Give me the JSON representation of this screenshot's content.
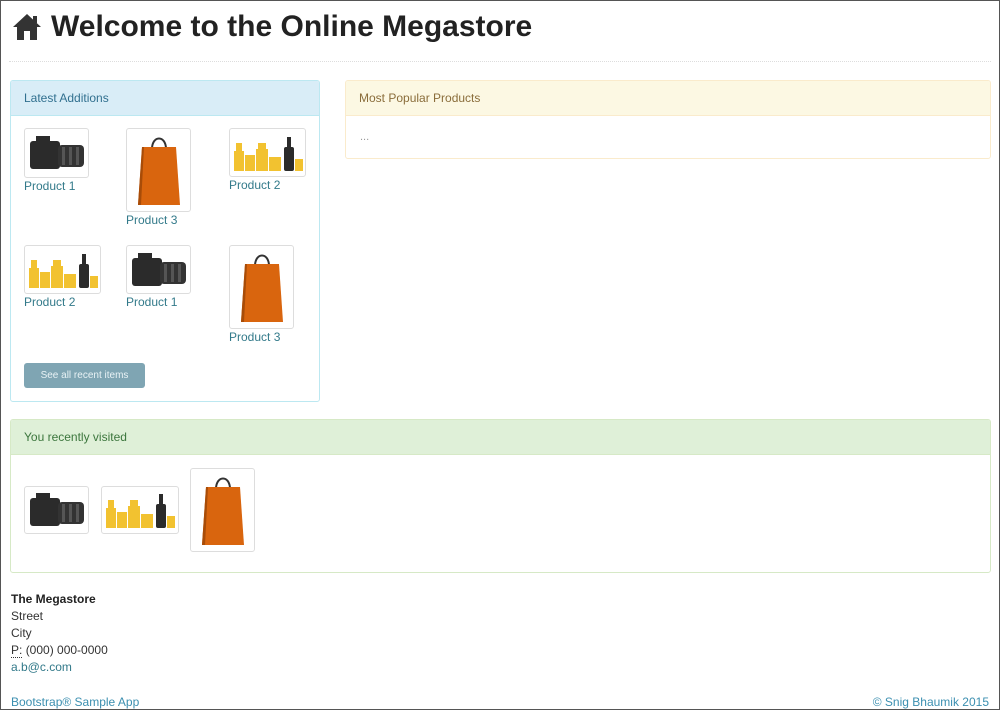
{
  "header": {
    "title": "Welcome to the Online Megastore",
    "icon": "home-icon"
  },
  "latest": {
    "heading": "Latest Additions",
    "items": [
      {
        "label": "Product 1",
        "icon": "camera-icon"
      },
      {
        "label": "Product 3",
        "icon": "shopping-bag-icon"
      },
      {
        "label": "Product 2",
        "icon": "cosmetics-icon"
      },
      {
        "label": "Product 2",
        "icon": "cosmetics-icon"
      },
      {
        "label": "Product 1",
        "icon": "camera-icon"
      },
      {
        "label": "Product 3",
        "icon": "shopping-bag-icon"
      }
    ],
    "button_label": "See all recent items"
  },
  "popular": {
    "heading": "Most Popular Products",
    "body": "..."
  },
  "visited": {
    "heading": "You recently visited",
    "items": [
      {
        "icon": "camera-icon"
      },
      {
        "icon": "cosmetics-icon"
      },
      {
        "icon": "shopping-bag-icon"
      }
    ]
  },
  "address": {
    "name": "The Megastore",
    "street": "Street",
    "city": "City",
    "phone_abbr": "P:",
    "phone": "(000) 000-0000",
    "email": "a.b@c.com"
  },
  "footer": {
    "left": "Bootstrap® Sample App",
    "right": "© Snig Bhaumik 2015"
  },
  "colors": {
    "bag": "#d9650e",
    "cosmetics": "#f2c230",
    "camera": "#2b2b2b"
  }
}
